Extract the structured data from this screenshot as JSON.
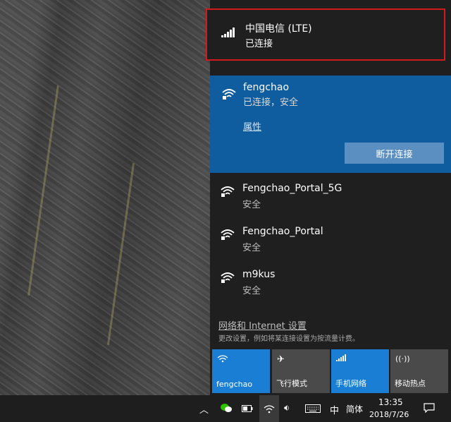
{
  "cellular": {
    "name": "中国电信 (LTE)",
    "status": "已连接"
  },
  "active_wifi": {
    "name": "fengchao",
    "status": "已连接，安全",
    "properties_link": "属性",
    "disconnect_button": "断开连接"
  },
  "networks": [
    {
      "name": "Fengchao_Portal_5G",
      "status": "安全"
    },
    {
      "name": "Fengchao_Portal",
      "status": "安全"
    },
    {
      "name": "m9kus",
      "status": "安全"
    }
  ],
  "settings": {
    "link": "网络和 Internet 设置",
    "description": "更改设置，例如将某连接设置为按流量计费。"
  },
  "quick_actions": [
    {
      "label": "fengchao",
      "icon": "wifi-icon",
      "active": true
    },
    {
      "label": "飞行模式",
      "icon": "airplane-icon",
      "active": false
    },
    {
      "label": "手机网络",
      "icon": "cellular-icon",
      "active": true
    },
    {
      "label": "移动热点",
      "icon": "hotspot-icon",
      "active": false
    }
  ],
  "taskbar": {
    "ime_mode": "中",
    "ime_layout": "简体",
    "time": "13:35",
    "date": "2018/7/26"
  },
  "colors": {
    "accent": "#1a7fd4",
    "active_bg": "#0f5c9e",
    "highlight_border": "#d11a1a"
  }
}
